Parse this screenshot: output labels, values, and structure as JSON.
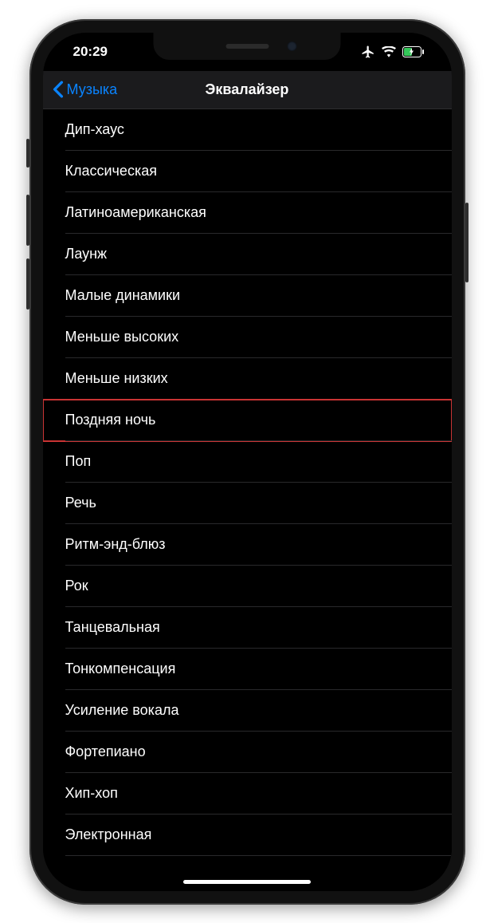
{
  "status": {
    "time": "20:29"
  },
  "nav": {
    "back_label": "Музыка",
    "title": "Эквалайзер"
  },
  "highlighted_label": "Поздняя ночь",
  "presets": [
    {
      "label": "Дип-хаус"
    },
    {
      "label": "Классическая"
    },
    {
      "label": "Латиноамериканская"
    },
    {
      "label": "Лаунж"
    },
    {
      "label": "Малые динамики"
    },
    {
      "label": "Меньше высоких"
    },
    {
      "label": "Меньше низких"
    },
    {
      "label": "Поздняя ночь"
    },
    {
      "label": "Поп"
    },
    {
      "label": "Речь"
    },
    {
      "label": "Ритм-энд-блюз"
    },
    {
      "label": "Рок"
    },
    {
      "label": "Танцевальная"
    },
    {
      "label": "Тонкомпенсация"
    },
    {
      "label": "Усиление вокала"
    },
    {
      "label": "Фортепиано"
    },
    {
      "label": "Хип-хоп"
    },
    {
      "label": "Электронная"
    }
  ]
}
